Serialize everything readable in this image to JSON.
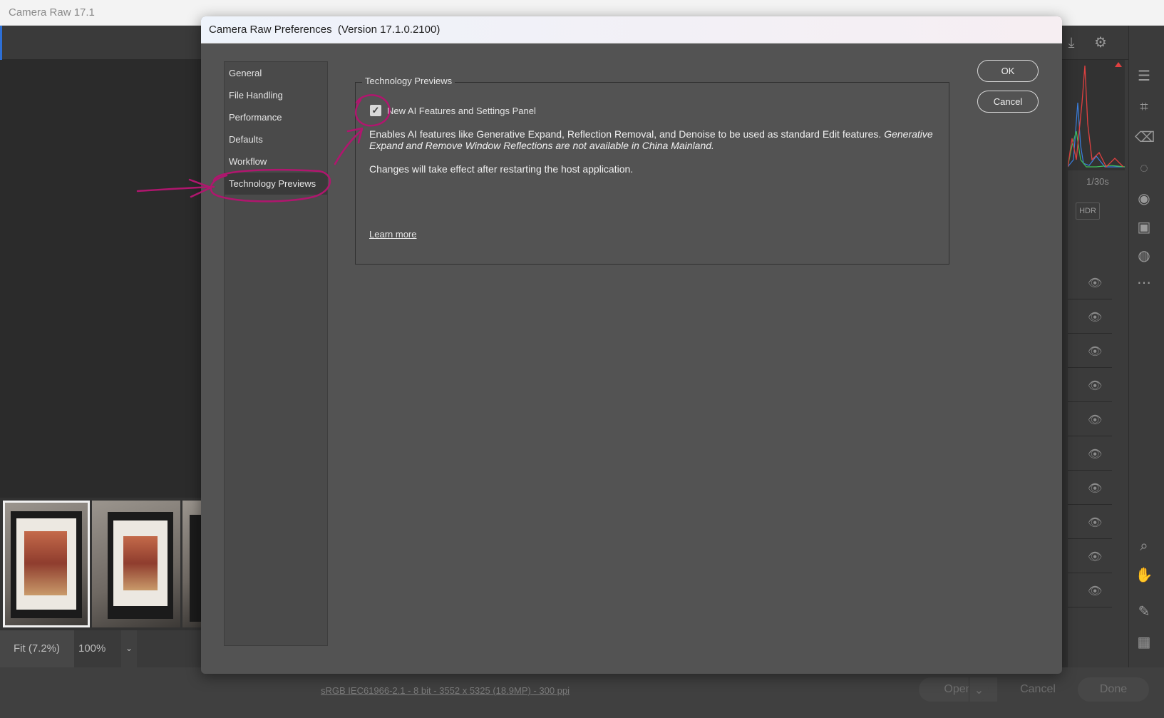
{
  "app": {
    "title": "Camera Raw 17.1",
    "shutter_speed": "1/30s",
    "hdr_label": "HDR",
    "zoom_fit": "Fit (7.2%)",
    "zoom_level": "100%",
    "file_info": "sRGB IEC61966-2.1 - 8 bit - 3552 x 5325 (18.9MP) - 300 ppi",
    "buttons": {
      "open": "Open",
      "cancel": "Cancel",
      "done": "Done"
    }
  },
  "dialog": {
    "title": "Camera Raw Preferences  (Version 17.1.0.2100)",
    "nav": [
      {
        "label": "General"
      },
      {
        "label": "File Handling"
      },
      {
        "label": "Performance"
      },
      {
        "label": "Defaults"
      },
      {
        "label": "Workflow"
      },
      {
        "label": "Technology Previews",
        "selected": true
      }
    ],
    "section": {
      "legend": "Technology Previews",
      "checkbox_label": "New AI Features and Settings Panel",
      "checkbox_checked": true,
      "description": "Enables AI features like Generative Expand, Reflection Removal, and Denoise to be used as standard Edit features.",
      "description_italic": "Generative Expand and Remove Window Reflections are not available in China Mainland.",
      "restart_note": "Changes will take effect after restarting the host application.",
      "learn_more": "Learn more"
    },
    "buttons": {
      "ok": "OK",
      "cancel": "Cancel"
    }
  },
  "colors": {
    "annotation": "#b0166e",
    "dialog_bg": "#535353",
    "app_bg": "#323232"
  }
}
